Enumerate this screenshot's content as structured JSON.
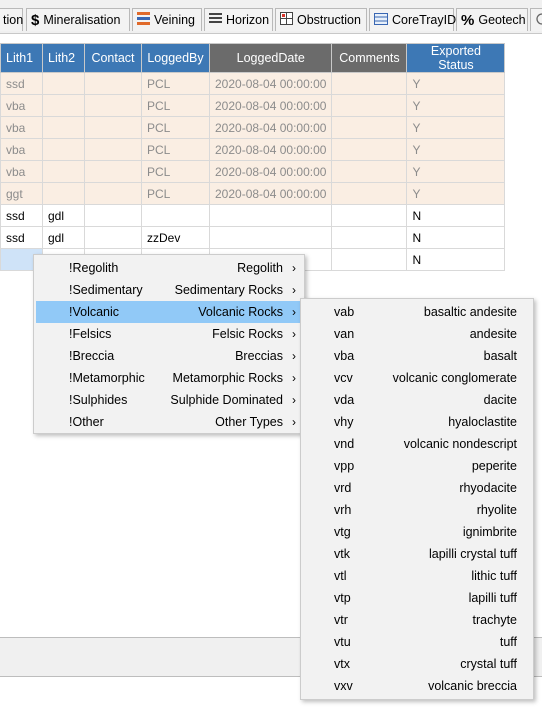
{
  "tabs": [
    {
      "label": "tion",
      "icon": ""
    },
    {
      "label": "Mineralisation",
      "icon": "dollar-icon"
    },
    {
      "label": "Veining",
      "icon": "veining-icon"
    },
    {
      "label": "Horizon",
      "icon": "horizon-icon"
    },
    {
      "label": "Obstruction",
      "icon": "obstruction-icon"
    },
    {
      "label": "CoreTrayID",
      "icon": "coretray-icon"
    },
    {
      "label": "Geotech",
      "icon": "percent-icon"
    },
    {
      "label": "",
      "icon": "partial-icon"
    }
  ],
  "grid": {
    "columns": [
      "Lith1",
      "Lith2",
      "Contact",
      "LoggedBy",
      "LoggedDate",
      "Comments",
      "Exported Status"
    ],
    "rows": [
      {
        "state": "exported",
        "cells": [
          "ssd",
          "",
          "",
          "PCL",
          "2020-08-04 00:00:00",
          "",
          "Y"
        ]
      },
      {
        "state": "exported",
        "cells": [
          "vba",
          "",
          "",
          "PCL",
          "2020-08-04 00:00:00",
          "",
          "Y"
        ]
      },
      {
        "state": "exported",
        "cells": [
          "vba",
          "",
          "",
          "PCL",
          "2020-08-04 00:00:00",
          "",
          "Y"
        ]
      },
      {
        "state": "exported",
        "cells": [
          "vba",
          "",
          "",
          "PCL",
          "2020-08-04 00:00:00",
          "",
          "Y"
        ]
      },
      {
        "state": "exported",
        "cells": [
          "vba",
          "",
          "",
          "PCL",
          "2020-08-04 00:00:00",
          "",
          "Y"
        ]
      },
      {
        "state": "exported",
        "cells": [
          "ggt",
          "",
          "",
          "PCL",
          "2020-08-04 00:00:00",
          "",
          "Y"
        ]
      },
      {
        "state": "editable",
        "cells": [
          "ssd",
          "gdl",
          "",
          "",
          "",
          "",
          "N"
        ]
      },
      {
        "state": "editable",
        "cells": [
          "ssd",
          "gdl",
          "",
          "zzDev",
          "",
          "",
          "N"
        ]
      },
      {
        "state": "editable",
        "cells": [
          "",
          "",
          "",
          "",
          "",
          "",
          "N"
        ]
      }
    ]
  },
  "context_menu": {
    "items": [
      {
        "code": "!Regolith",
        "label": "Regolith",
        "highlighted": false
      },
      {
        "code": "!Sedimentary",
        "label": "Sedimentary Rocks",
        "highlighted": false
      },
      {
        "code": "!Volcanic",
        "label": "Volcanic Rocks",
        "highlighted": true
      },
      {
        "code": "!Felsics",
        "label": "Felsic Rocks",
        "highlighted": false
      },
      {
        "code": "!Breccia",
        "label": "Breccias",
        "highlighted": false
      },
      {
        "code": "!Metamorphic",
        "label": "Metamorphic Rocks",
        "highlighted": false
      },
      {
        "code": "!Sulphides",
        "label": "Sulphide Dominated",
        "highlighted": false
      },
      {
        "code": "!Other",
        "label": "Other Types",
        "highlighted": false
      }
    ],
    "arrow": "›"
  },
  "submenu": {
    "items": [
      {
        "code": "vab",
        "label": "basaltic andesite"
      },
      {
        "code": "van",
        "label": "andesite"
      },
      {
        "code": "vba",
        "label": "basalt"
      },
      {
        "code": "vcv",
        "label": "volcanic conglomerate"
      },
      {
        "code": "vda",
        "label": "dacite"
      },
      {
        "code": "vhy",
        "label": "hyaloclastite"
      },
      {
        "code": "vnd",
        "label": "volcanic nondescript"
      },
      {
        "code": "vpp",
        "label": "peperite"
      },
      {
        "code": "vrd",
        "label": "rhyodacite"
      },
      {
        "code": "vrh",
        "label": "rhyolite"
      },
      {
        "code": "vtg",
        "label": "ignimbrite"
      },
      {
        "code": "vtk",
        "label": "lapilli crystal tuff"
      },
      {
        "code": "vtl",
        "label": "lithic tuff"
      },
      {
        "code": "vtp",
        "label": "lapilli tuff"
      },
      {
        "code": "vtr",
        "label": "trachyte"
      },
      {
        "code": "vtu",
        "label": "tuff"
      },
      {
        "code": "vtx",
        "label": "crystal tuff"
      },
      {
        "code": "vxv",
        "label": "volcanic breccia"
      }
    ]
  },
  "colors": {
    "header_blue": "#3d78b5",
    "header_gray": "#6b6b6b",
    "exported_row": "#faeee3",
    "menu_highlight": "#91c9f7",
    "selected_cell": "#cfe3f8"
  }
}
